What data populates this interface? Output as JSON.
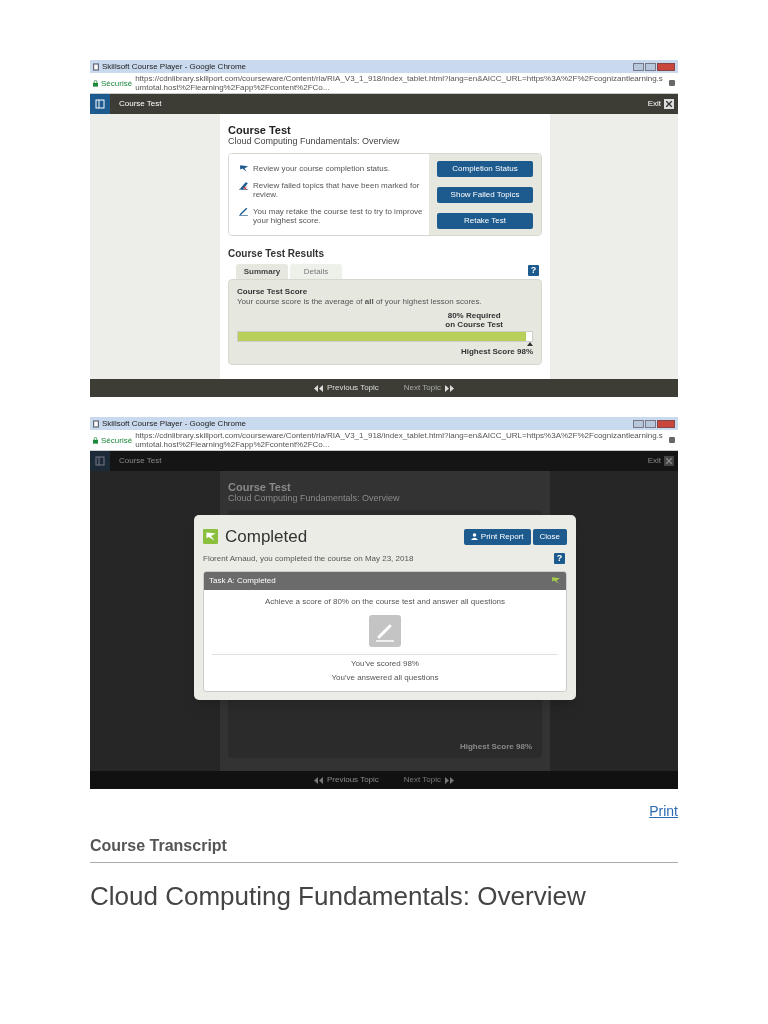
{
  "screenshots": [
    {
      "kind": "course",
      "window_title": "Skillsoft Course Player - Google Chrome",
      "secure_label": "Sécurisé",
      "url": "https://cdnlibrary.skillport.com/courseware/Content/ria/RIA_V3_1_918/index_tablet.html?lang=en&AICC_URL=https%3A%2F%2Fcognizantlearning.sumtotal.host%2Flearning%2Fapp%2Fcontent%2FCo...",
      "app_title": "Course Test",
      "exit_label": "Exit",
      "heading": "Course Test",
      "subheading": "Cloud Computing Fundamentals: Overview",
      "actions": [
        {
          "text": "Review your course completion status.",
          "button": "Completion Status"
        },
        {
          "text": "Review failed topics that have been marked for review.",
          "button": "Show Failed Topics"
        },
        {
          "text": "You may retake the course test to try to improve your highest score.",
          "button": "Retake Test"
        }
      ],
      "results_heading": "Course Test Results",
      "tabs": [
        {
          "label": "Summary",
          "selected": true
        },
        {
          "label": "Details",
          "selected": false
        }
      ],
      "help": "?",
      "score_title": "Course Test Score",
      "score_desc": "Your course score is the average of **all** of your highest lesson scores.",
      "required_lines": [
        "80% Required",
        "on Course Test"
      ],
      "level": 0.98,
      "highest_score": "Highest Score 98%",
      "nav": {
        "previous": "Previous Topic",
        "next": "Next Topic"
      }
    },
    {
      "kind": "completed_dialog",
      "window_title": "Skillsoft Course Player - Google Chrome",
      "secure_label": "Sécurisé",
      "url": "https://cdnlibrary.skillport.com/courseware/Content/ria/RIA_V3_1_918/index_tablet.html?lang=en&AICC_URL=https%3A%2F%2Fcognizantlearning.sumtotal.host%2Flearning%2Fapp%2Fcontent%2FCo...",
      "app_title": "Course Test",
      "exit_label": "Exit",
      "heading": "Course Test",
      "subheading": "Cloud Computing Fundamentals: Overview",
      "highest_score": "Highest Score 98%",
      "nav": {
        "previous": "Previous Topic",
        "next": "Next Topic"
      },
      "dialog": {
        "title": "Completed",
        "buttons": [
          "Print Report",
          "Close"
        ],
        "message": "Florent Arnaud, you completed the course on May 23, 2018",
        "help": "?",
        "task": {
          "title": "Task A: Completed",
          "requirement": "Achieve a score of 80% on the course test and answer all questions",
          "results": [
            "You've scored 98%",
            "You've answered all questions"
          ]
        }
      }
    }
  ],
  "print_link": "Print",
  "section_heading": "Course Transcript",
  "course_title": "Cloud Computing Fundamentals: Overview"
}
